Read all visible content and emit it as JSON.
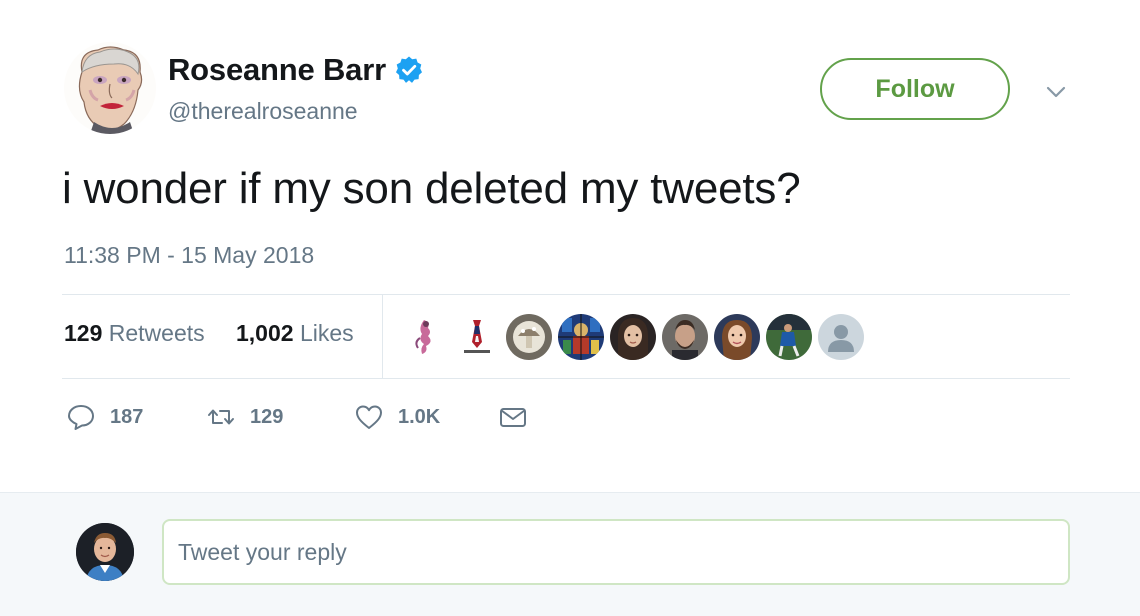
{
  "author": {
    "name": "Roseanne Barr",
    "handle": "@therealroseanne",
    "verified": true
  },
  "follow_label": "Follow",
  "tweet": {
    "text": "i wonder if my son deleted my tweets?",
    "timestamp": "11:38 PM - 15 May 2018"
  },
  "stats": {
    "retweets_count": "129",
    "retweets_label": "Retweets",
    "likes_count": "1,002",
    "likes_label": "Likes"
  },
  "likers": [
    {
      "icon": "pink-figure-avatar"
    },
    {
      "icon": "flag-tie-avatar"
    },
    {
      "icon": "mushroom-art-avatar"
    },
    {
      "icon": "stained-glass-avatar"
    },
    {
      "icon": "woman-portrait-avatar"
    },
    {
      "icon": "bearded-man-avatar"
    },
    {
      "icon": "woman-portrait-avatar"
    },
    {
      "icon": "soccer-player-avatar"
    },
    {
      "icon": "default-user-avatar"
    }
  ],
  "actions": {
    "reply_count": "187",
    "retweet_count": "129",
    "like_count": "1.0K"
  },
  "reply_box": {
    "placeholder": "Tweet your reply"
  },
  "colors": {
    "follow_green": "#5c9a42",
    "verified_blue": "#1da1f2",
    "secondary_text": "#657786",
    "primary_text": "#14171a"
  }
}
